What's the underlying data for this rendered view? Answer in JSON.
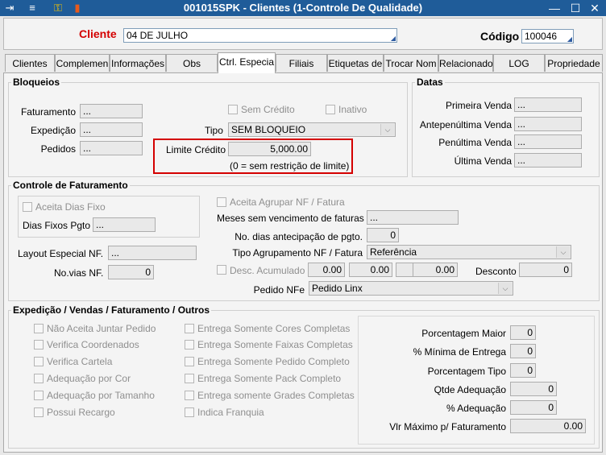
{
  "window": {
    "title": "001015SPK - Clientes (1-Controle De Qualidade)",
    "minimize": "—",
    "maximize": "☐",
    "close": "✕"
  },
  "header": {
    "cliente_label": "Cliente",
    "cliente_value": "04 DE JULHO",
    "codigo_label": "Código",
    "codigo_value": "100046"
  },
  "tabs": [
    "Clientes",
    "Complemen",
    "Informações",
    "Obs",
    "Ctrl. Especia",
    "Filiais",
    "Etiquetas de",
    "Trocar Nom",
    "Relacionado",
    "LOG",
    "Propriedade"
  ],
  "bloqueios": {
    "title": "Bloqueios",
    "faturamento_label": "Faturamento",
    "faturamento_value": "...",
    "expedicao_label": "Expedição",
    "expedicao_value": "...",
    "pedidos_label": "Pedidos",
    "pedidos_value": "...",
    "sem_credito": "Sem Crédito",
    "inativo": "Inativo",
    "tipo_label": "Tipo",
    "tipo_value": "SEM BLOQUEIO",
    "limite_label": "Limite Crédito",
    "limite_value": "5,000.00",
    "limite_note": "(0 = sem restrição de limite)"
  },
  "datas": {
    "title": "Datas",
    "primeira_label": "Primeira Venda",
    "primeira_value": "...",
    "antepenultima_label": "Antepenúltima Venda",
    "antepenultima_value": "...",
    "penultima_label": "Penúltima Venda",
    "penultima_value": "...",
    "ultima_label": "Última Venda",
    "ultima_value": "..."
  },
  "controle": {
    "title": "Controle de Faturamento",
    "aceita_dias_fixo": "Aceita Dias Fixo",
    "dias_fixos_label": "Dias Fixos Pgto",
    "dias_fixos_value": "...",
    "aceita_agrupar": "Aceita Agrupar NF / Fatura",
    "meses_label": "Meses sem vencimento de faturas",
    "meses_value": "...",
    "antecipacao_label": "No. dias antecipação de pgto.",
    "antecipacao_value": "0",
    "layout_label": "Layout Especial NF.",
    "layout_value": "...",
    "tipo_agrup_label": "Tipo Agrupamento NF / Fatura",
    "tipo_agrup_value": "Referência",
    "novias_label": "No.vias NF.",
    "novias_value": "0",
    "desc_acumulado": "Desc. Acumulado",
    "desc_values": [
      "0.00",
      "0.00",
      "0.00",
      "0.00"
    ],
    "desconto_label": "Desconto",
    "desconto_value": "0",
    "pedido_nfe_label": "Pedido NFe",
    "pedido_nfe_value": "Pedido Linx"
  },
  "expedicao": {
    "title": "Expedição / Vendas / Faturamento / Outros",
    "left_checks": [
      "Não Aceita Juntar Pedido",
      "Verifica Coordenados",
      "Verifica Cartela",
      "Adequação por Cor",
      "Adequação por Tamanho",
      "Possui Recargo"
    ],
    "mid_checks": [
      "Entrega Somente Cores Completas",
      "Entrega Somente Faixas Completas",
      "Entrega Somente Pedido Completo",
      "Entrega Somente Pack Completo",
      "Entrega somente Grades Completas",
      "Indica Franquia"
    ],
    "fields": [
      {
        "label": "Porcentagem Maior",
        "value": "0"
      },
      {
        "label": "% Mínima de Entrega",
        "value": "0"
      },
      {
        "label": "Porcentagem Tipo",
        "value": "0"
      },
      {
        "label": "Qtde Adequação",
        "value": "0"
      },
      {
        "label": "% Adequação",
        "value": "0"
      },
      {
        "label": "Vlr Máximo p/ Faturamento",
        "value": "0.00"
      }
    ]
  }
}
